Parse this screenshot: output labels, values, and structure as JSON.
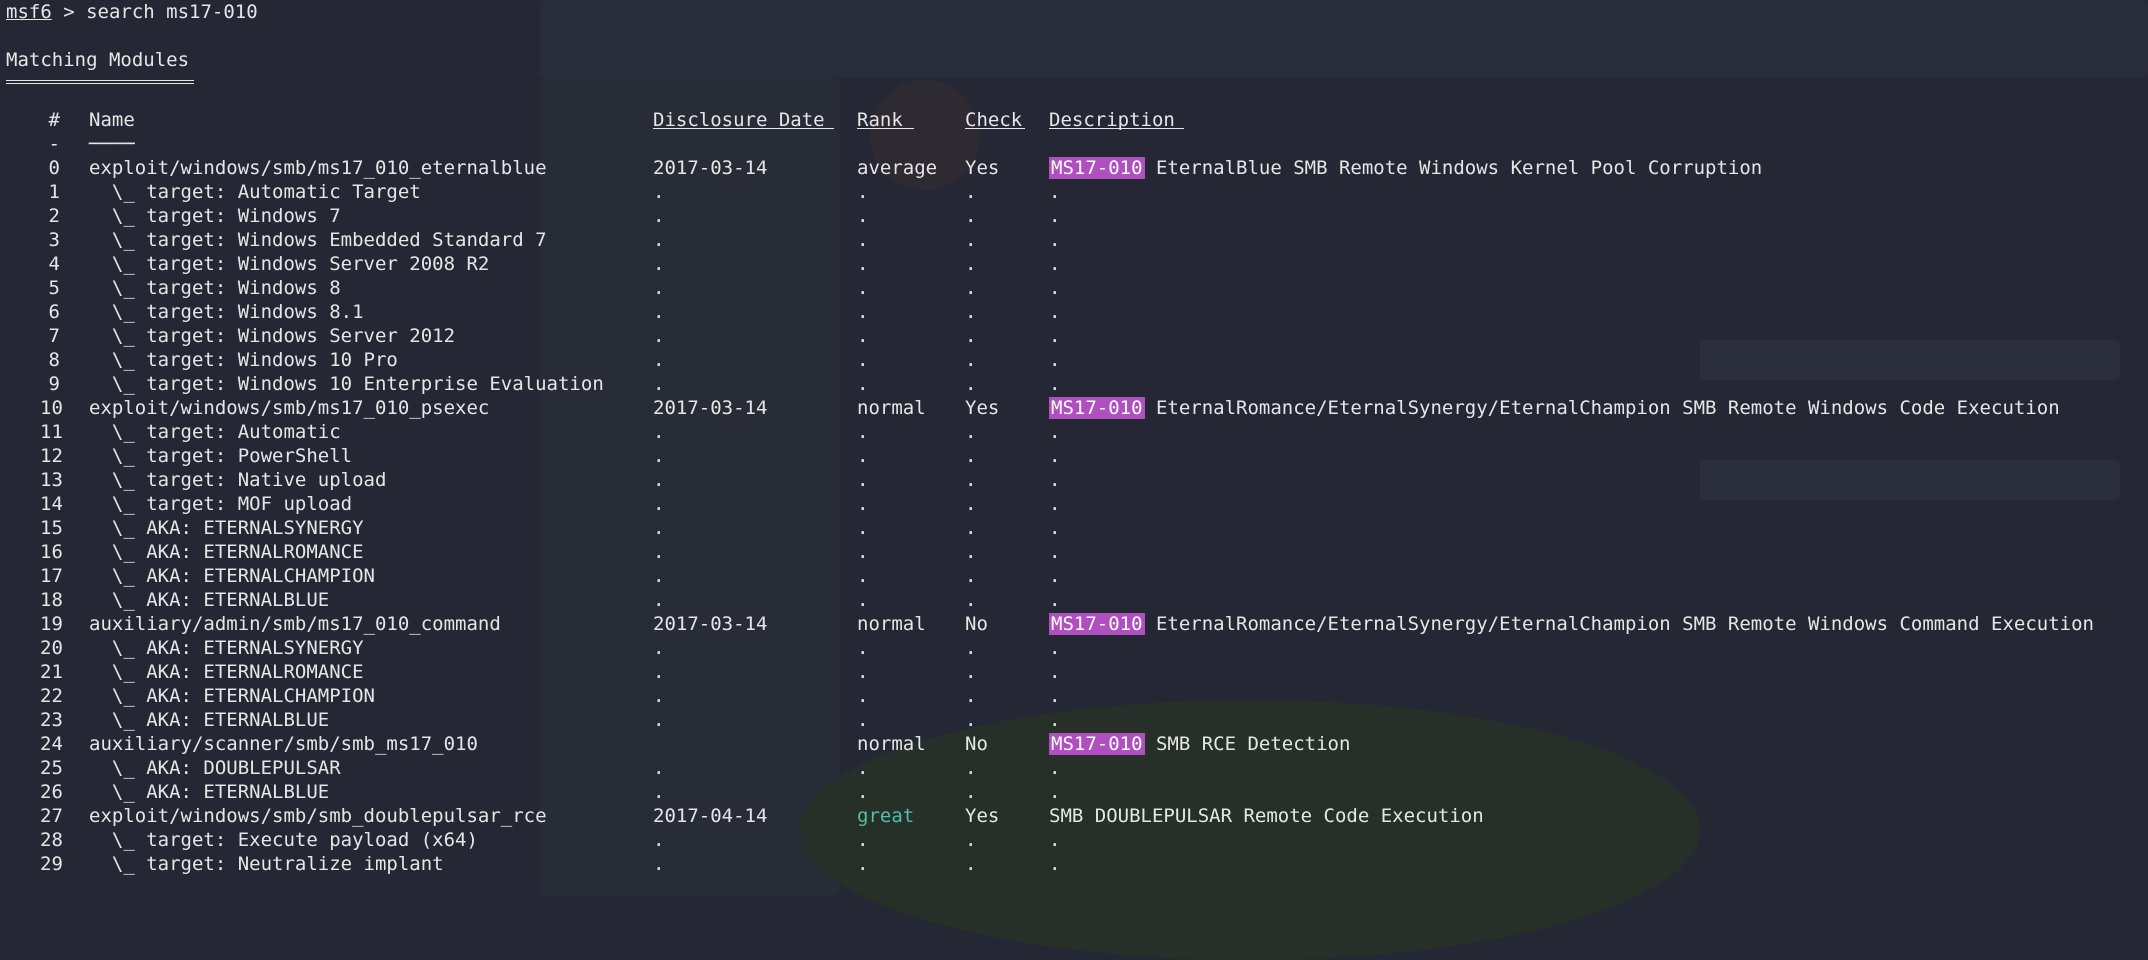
{
  "prompt": {
    "app": "msf6",
    "separator": " > ",
    "command": "search ms17-010"
  },
  "heading": "Matching Modules",
  "columns": {
    "num": "#",
    "name": "Name",
    "date": "Disclosure Date",
    "rank": "Rank",
    "check": "Check",
    "desc": "Description"
  },
  "header_underline": {
    "num": "-",
    "name": "────"
  },
  "highlight_color": "#b04fbf",
  "great_color": "#4fc1a8",
  "rows": [
    {
      "num": "0",
      "name": "exploit/windows/smb/ms17_010_eternalblue",
      "date": "2017-03-14",
      "rank": "average",
      "check": "Yes",
      "tag": "MS17-010",
      "desc": " EternalBlue SMB Remote Windows Kernel Pool Corruption"
    },
    {
      "num": "1",
      "name": "  \\_ target: Automatic Target",
      "date": ".",
      "rank": ".",
      "check": ".",
      "desc": "."
    },
    {
      "num": "2",
      "name": "  \\_ target: Windows 7",
      "date": ".",
      "rank": ".",
      "check": ".",
      "desc": "."
    },
    {
      "num": "3",
      "name": "  \\_ target: Windows Embedded Standard 7",
      "date": ".",
      "rank": ".",
      "check": ".",
      "desc": "."
    },
    {
      "num": "4",
      "name": "  \\_ target: Windows Server 2008 R2",
      "date": ".",
      "rank": ".",
      "check": ".",
      "desc": "."
    },
    {
      "num": "5",
      "name": "  \\_ target: Windows 8",
      "date": ".",
      "rank": ".",
      "check": ".",
      "desc": "."
    },
    {
      "num": "6",
      "name": "  \\_ target: Windows 8.1",
      "date": ".",
      "rank": ".",
      "check": ".",
      "desc": "."
    },
    {
      "num": "7",
      "name": "  \\_ target: Windows Server 2012",
      "date": ".",
      "rank": ".",
      "check": ".",
      "desc": "."
    },
    {
      "num": "8",
      "name": "  \\_ target: Windows 10 Pro",
      "date": ".",
      "rank": ".",
      "check": ".",
      "desc": "."
    },
    {
      "num": "9",
      "name": "  \\_ target: Windows 10 Enterprise Evaluation",
      "date": ".",
      "rank": ".",
      "check": ".",
      "desc": "."
    },
    {
      "num": "10",
      "name": "exploit/windows/smb/ms17_010_psexec",
      "date": "2017-03-14",
      "rank": "normal",
      "check": "Yes",
      "tag": "MS17-010",
      "desc": " EternalRomance/EternalSynergy/EternalChampion SMB Remote Windows Code Execution"
    },
    {
      "num": "11",
      "name": "  \\_ target: Automatic",
      "date": ".",
      "rank": ".",
      "check": ".",
      "desc": "."
    },
    {
      "num": "12",
      "name": "  \\_ target: PowerShell",
      "date": ".",
      "rank": ".",
      "check": ".",
      "desc": "."
    },
    {
      "num": "13",
      "name": "  \\_ target: Native upload",
      "date": ".",
      "rank": ".",
      "check": ".",
      "desc": "."
    },
    {
      "num": "14",
      "name": "  \\_ target: MOF upload",
      "date": ".",
      "rank": ".",
      "check": ".",
      "desc": "."
    },
    {
      "num": "15",
      "name": "  \\_ AKA: ETERNALSYNERGY",
      "date": ".",
      "rank": ".",
      "check": ".",
      "desc": "."
    },
    {
      "num": "16",
      "name": "  \\_ AKA: ETERNALROMANCE",
      "date": ".",
      "rank": ".",
      "check": ".",
      "desc": "."
    },
    {
      "num": "17",
      "name": "  \\_ AKA: ETERNALCHAMPION",
      "date": ".",
      "rank": ".",
      "check": ".",
      "desc": "."
    },
    {
      "num": "18",
      "name": "  \\_ AKA: ETERNALBLUE",
      "date": ".",
      "rank": ".",
      "check": ".",
      "desc": "."
    },
    {
      "num": "19",
      "name": "auxiliary/admin/smb/ms17_010_command",
      "date": "2017-03-14",
      "rank": "normal",
      "check": "No",
      "tag": "MS17-010",
      "desc": " EternalRomance/EternalSynergy/EternalChampion SMB Remote Windows Command Execution"
    },
    {
      "num": "20",
      "name": "  \\_ AKA: ETERNALSYNERGY",
      "date": ".",
      "rank": ".",
      "check": ".",
      "desc": "."
    },
    {
      "num": "21",
      "name": "  \\_ AKA: ETERNALROMANCE",
      "date": ".",
      "rank": ".",
      "check": ".",
      "desc": "."
    },
    {
      "num": "22",
      "name": "  \\_ AKA: ETERNALCHAMPION",
      "date": ".",
      "rank": ".",
      "check": ".",
      "desc": "."
    },
    {
      "num": "23",
      "name": "  \\_ AKA: ETERNALBLUE",
      "date": ".",
      "rank": ".",
      "check": ".",
      "desc": "."
    },
    {
      "num": "24",
      "name": "auxiliary/scanner/smb/smb_ms17_010",
      "date": "",
      "rank": "normal",
      "check": "No",
      "tag": "MS17-010",
      "desc": " SMB RCE Detection"
    },
    {
      "num": "25",
      "name": "  \\_ AKA: DOUBLEPULSAR",
      "date": ".",
      "rank": ".",
      "check": ".",
      "desc": "."
    },
    {
      "num": "26",
      "name": "  \\_ AKA: ETERNALBLUE",
      "date": ".",
      "rank": ".",
      "check": ".",
      "desc": "."
    },
    {
      "num": "27",
      "name": "exploit/windows/smb/smb_doublepulsar_rce",
      "date": "2017-04-14",
      "rank": "great",
      "check": "Yes",
      "desc": "SMB DOUBLEPULSAR Remote Code Execution"
    },
    {
      "num": "28",
      "name": "  \\_ target: Execute payload (x64)",
      "date": ".",
      "rank": ".",
      "check": ".",
      "desc": "."
    },
    {
      "num": "29",
      "name": "  \\_ target: Neutralize implant",
      "date": ".",
      "rank": ".",
      "check": ".",
      "desc": "."
    }
  ]
}
